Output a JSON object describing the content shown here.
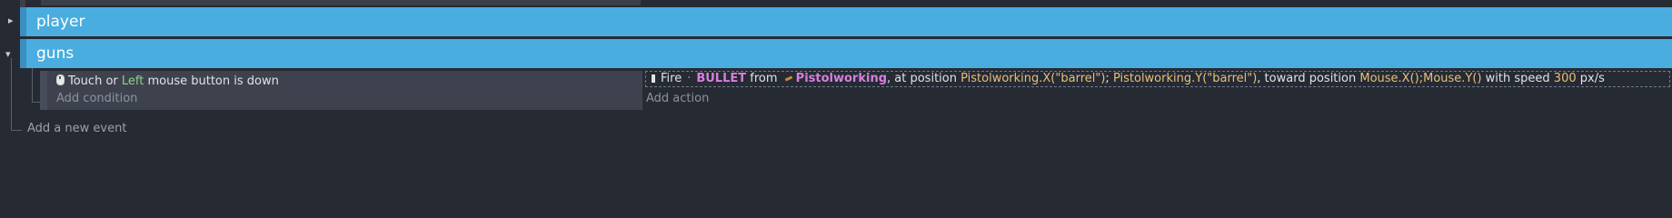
{
  "groups": [
    {
      "label": "player",
      "toggle": "▸"
    },
    {
      "label": "guns",
      "toggle": "▾"
    }
  ],
  "event": {
    "condition": {
      "part1": "Touch or ",
      "highlight": "Left",
      "part2": " mouse button is down"
    },
    "add_condition": "Add condition",
    "action": {
      "verb": "Fire",
      "object": "BULLET",
      "from": "from",
      "source": "Pistolworking",
      "at_position": ", at position",
      "pos_x": "Pistolworking.X(\"barrel\")",
      "sep": ";",
      "pos_y": "Pistolworking.Y(\"barrel\")",
      "toward": ", toward position",
      "target_x": "Mouse.X()",
      "target_sep": ";",
      "target_y": "Mouse.Y()",
      "with_speed": " with speed",
      "speed": "300",
      "unit": "px/s"
    },
    "add_action": "Add action"
  },
  "add_event": "Add a new event",
  "colors": {
    "group_bg": "#4aade0",
    "keyword": "#d77fe0",
    "expression": "#e6c07b",
    "highlight_green": "#8fd18a",
    "background": "#262a33"
  },
  "icons": [
    "mouse-icon",
    "bullet-object-icon",
    "pistol-object-icon",
    "expand-arrow-icon",
    "collapse-arrow-icon"
  ]
}
